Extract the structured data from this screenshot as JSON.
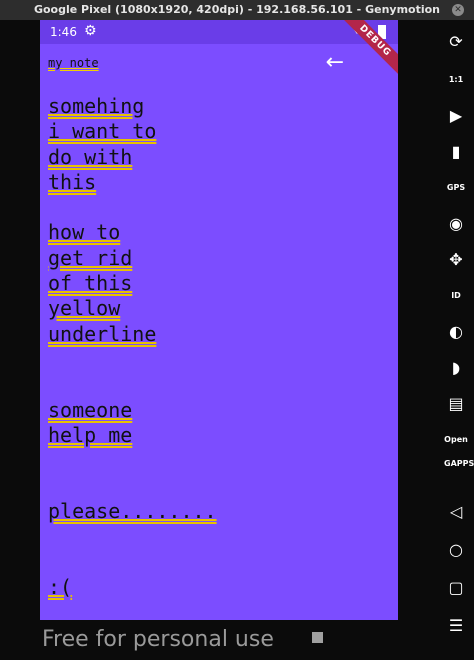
{
  "window": {
    "title": "Google Pixel (1080x1920, 420dpi) - 192.168.56.101 - Genymotion"
  },
  "statusbar": {
    "time": "1:46"
  },
  "debug_banner": "DEBUG",
  "appbar": {
    "title": "my note"
  },
  "note": {
    "body": "somehing\ni want to\ndo with\nthis\n\nhow to\nget rid\nof this\nyellow\nunderline\n\n\nsomeone\nhelp me\n\n\nplease........\n\n\n:("
  },
  "sidebar": {
    "gps_label": "GPS",
    "id_label": "ID",
    "opengapps_label": "Open GAPPS",
    "scale_label": "1:1"
  },
  "watermark": "Free for personal use",
  "colors": {
    "app_background": "#7c4dff",
    "status_bar": "#6a3de8",
    "underline": "#e8c200",
    "debug_ribbon": "#b3264a"
  }
}
